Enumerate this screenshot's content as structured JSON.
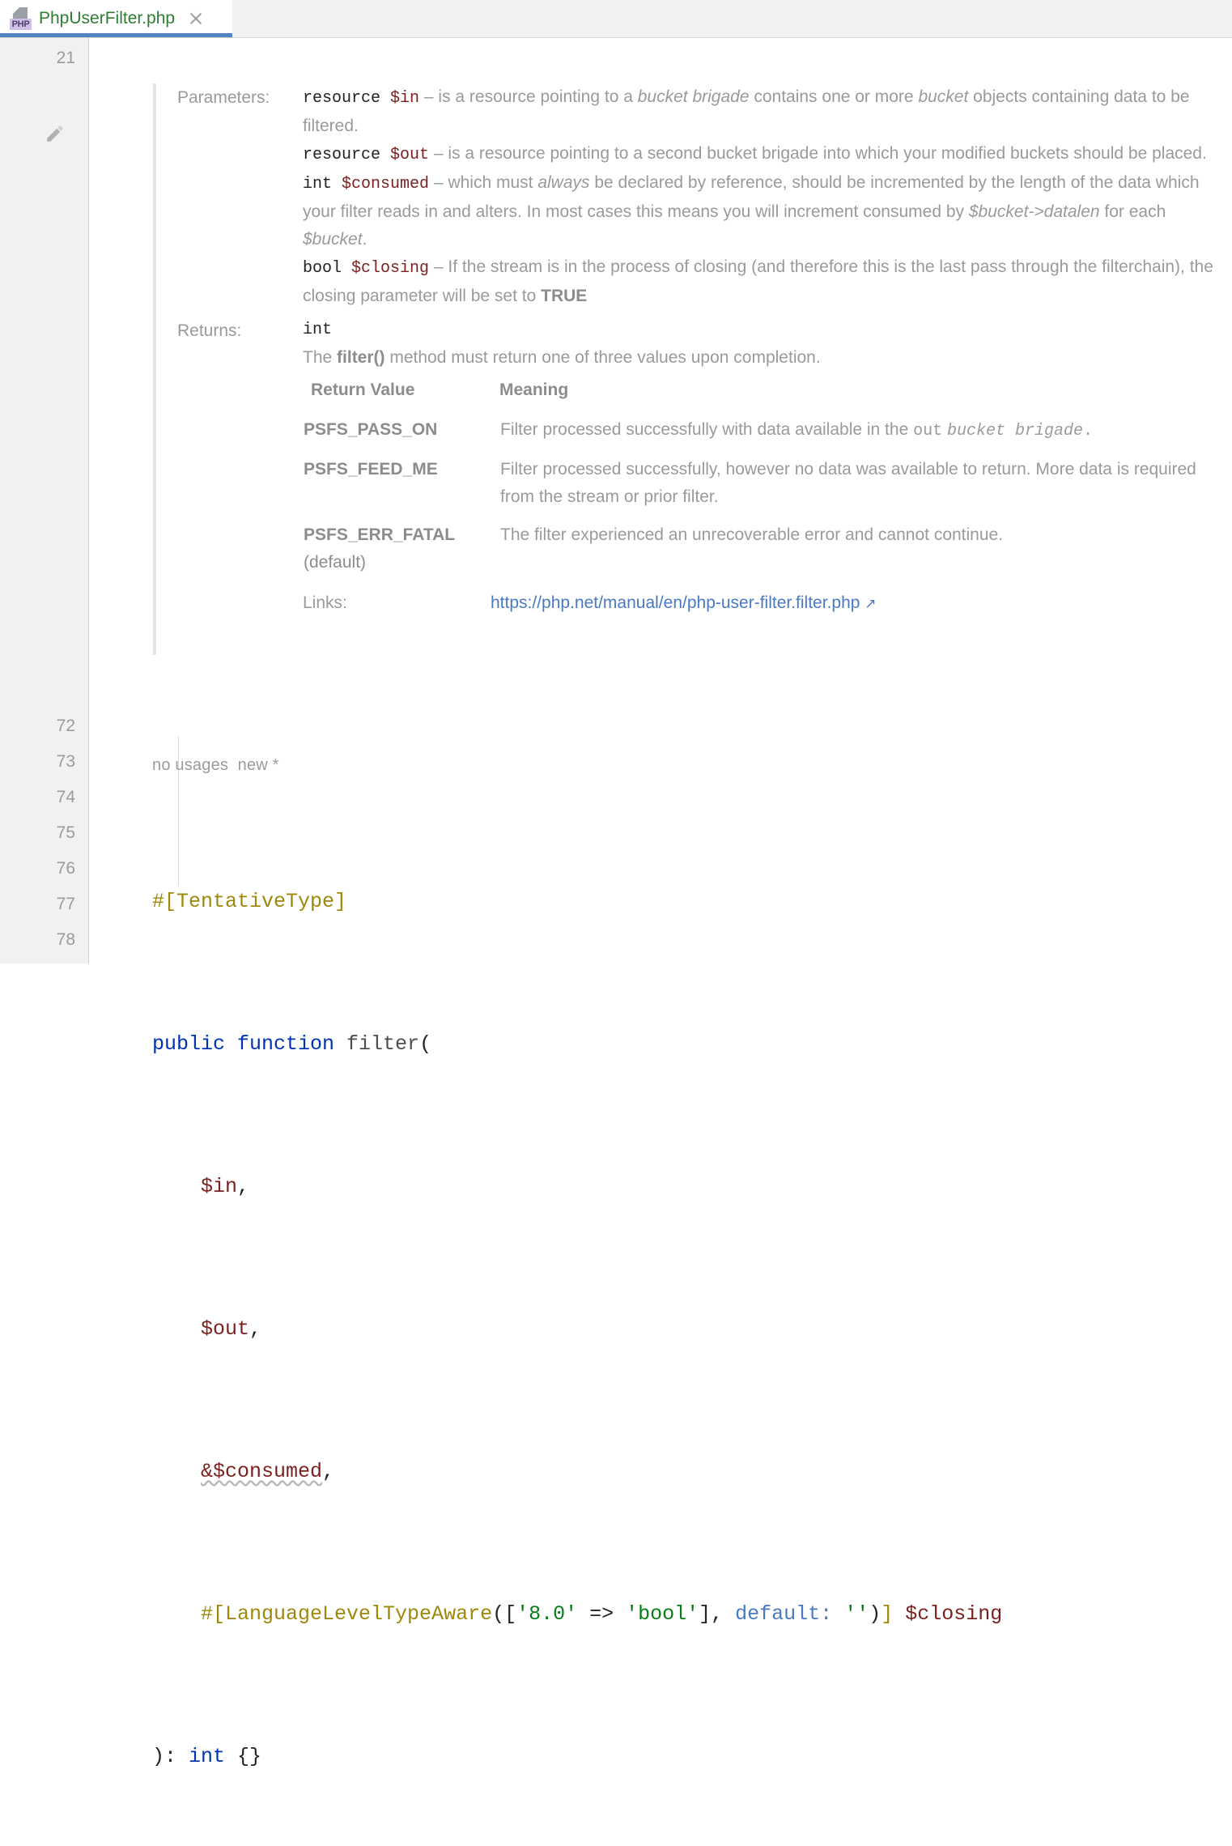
{
  "tab": {
    "filename": "PhpUserFilter.php",
    "icon": "php-file-icon",
    "icon_label": "PHP",
    "close_label": "×",
    "accent_color": "#5383c3",
    "title_color": "#2e7d32"
  },
  "gutter": {
    "top_line_number": "21",
    "edit_icon": "pencil-icon",
    "line_numbers": [
      "72",
      "73",
      "74",
      "75",
      "76",
      "77",
      "78"
    ]
  },
  "doc": {
    "parameters_label": "Parameters:",
    "returns_label": "Returns:",
    "links_label": "Links:",
    "params": [
      {
        "type": "resource",
        "name": "$in",
        "dash": "–",
        "desc_parts": [
          {
            "text": " is a resource pointing to a ",
            "style": "plain"
          },
          {
            "text": "bucket brigade",
            "style": "italic"
          },
          {
            "text": " contains one or more ",
            "style": "plain"
          },
          {
            "text": "bucket",
            "style": "italic"
          },
          {
            "text": " objects containing data to be filtered.",
            "style": "plain"
          }
        ]
      },
      {
        "type": "resource",
        "name": "$out",
        "dash": "–",
        "desc_parts": [
          {
            "text": "is a resource pointing to a second bucket brigade into which your modified buckets should be placed.",
            "style": "plain"
          }
        ]
      },
      {
        "type": "int",
        "name": "$consumed",
        "dash": "–",
        "desc_parts": [
          {
            "text": "which must ",
            "style": "plain"
          },
          {
            "text": "always",
            "style": "italic"
          },
          {
            "text": " be declared by reference, should be incremented by the length of the data which your filter reads in and alters. In most cases this means you will increment consumed by ",
            "style": "plain"
          },
          {
            "text": "$bucket->datalen",
            "style": "italic"
          },
          {
            "text": " for each ",
            "style": "plain"
          },
          {
            "text": "$bucket",
            "style": "italic"
          },
          {
            "text": ".",
            "style": "plain"
          }
        ]
      },
      {
        "type": "bool",
        "name": "$closing",
        "dash": "–",
        "desc_parts": [
          {
            "text": "If the stream is in the process of closing (and therefore this is the last pass through the filterchain), the closing parameter will be set to ",
            "style": "plain"
          },
          {
            "text": "TRUE",
            "style": "bold"
          }
        ]
      }
    ],
    "returns": {
      "type": "int",
      "summary_pre": "The ",
      "summary_bold": "filter()",
      "summary_post": " method must return one of three values upon completion.",
      "table": {
        "headers": [
          "Return Value",
          "Meaning"
        ],
        "rows": [
          {
            "value": "PSFS_PASS_ON",
            "meaning_parts": [
              {
                "text": "Filter processed successfully with data available in the ",
                "style": "plain"
              },
              {
                "text": "out",
                "style": "mono"
              },
              {
                "text": " ",
                "style": "plain"
              },
              {
                "text": "bucket brigade",
                "style": "mono-italic"
              },
              {
                "text": ".",
                "style": "mono"
              }
            ]
          },
          {
            "value": "PSFS_FEED_ME",
            "meaning_parts": [
              {
                "text": "Filter processed successfully, however no data was available to return. More data is required from the stream or prior filter.",
                "style": "plain"
              }
            ]
          },
          {
            "value": "PSFS_ERR_FATAL",
            "value_suffix": " (default)",
            "meaning_parts": [
              {
                "text": "The filter experienced an unrecoverable error and cannot continue.",
                "style": "plain"
              }
            ]
          }
        ]
      }
    },
    "link": {
      "url_text": "https://php.net/manual/en/php-user-filter.filter.php",
      "external_icon": "↗",
      "color": "#4a79c4"
    }
  },
  "code": {
    "usage_hint": "no usages",
    "new_hint": "new *",
    "lines": [
      {
        "n": "72",
        "tokens": [
          {
            "t": "#[TentativeType]",
            "c": "attr"
          }
        ]
      },
      {
        "n": "73",
        "tokens": [
          {
            "t": "public function ",
            "c": "kw"
          },
          {
            "t": "filter",
            "c": "ident"
          },
          {
            "t": "(",
            "c": "punc"
          }
        ]
      },
      {
        "n": "74",
        "tokens": [
          {
            "t": "    ",
            "c": "punc"
          },
          {
            "t": "$in",
            "c": "var"
          },
          {
            "t": ",",
            "c": "punc"
          }
        ]
      },
      {
        "n": "75",
        "tokens": [
          {
            "t": "    ",
            "c": "punc"
          },
          {
            "t": "$out",
            "c": "var"
          },
          {
            "t": ",",
            "c": "punc"
          }
        ]
      },
      {
        "n": "76",
        "tokens": [
          {
            "t": "    ",
            "c": "punc"
          },
          {
            "t": "&$consumed",
            "c": "var squiggle"
          },
          {
            "t": ",",
            "c": "punc"
          }
        ]
      },
      {
        "n": "77",
        "tokens": [
          {
            "t": "    ",
            "c": "punc"
          },
          {
            "t": "#[LanguageLevelTypeAware",
            "c": "attr"
          },
          {
            "t": "([",
            "c": "punc"
          },
          {
            "t": "'8.0'",
            "c": "str"
          },
          {
            "t": " => ",
            "c": "punc"
          },
          {
            "t": "'bool'",
            "c": "str"
          },
          {
            "t": "], ",
            "c": "punc"
          },
          {
            "t": "default:",
            "c": "named"
          },
          {
            "t": " ",
            "c": "punc"
          },
          {
            "t": "''",
            "c": "str"
          },
          {
            "t": ")",
            "c": "punc"
          },
          {
            "t": "]",
            "c": "attr"
          },
          {
            "t": " ",
            "c": "punc"
          },
          {
            "t": "$closing",
            "c": "var"
          }
        ]
      },
      {
        "n": "78",
        "tokens": [
          {
            "t": "): ",
            "c": "punc"
          },
          {
            "t": "int",
            "c": "kw"
          },
          {
            "t": " {}",
            "c": "punc"
          }
        ]
      }
    ]
  }
}
